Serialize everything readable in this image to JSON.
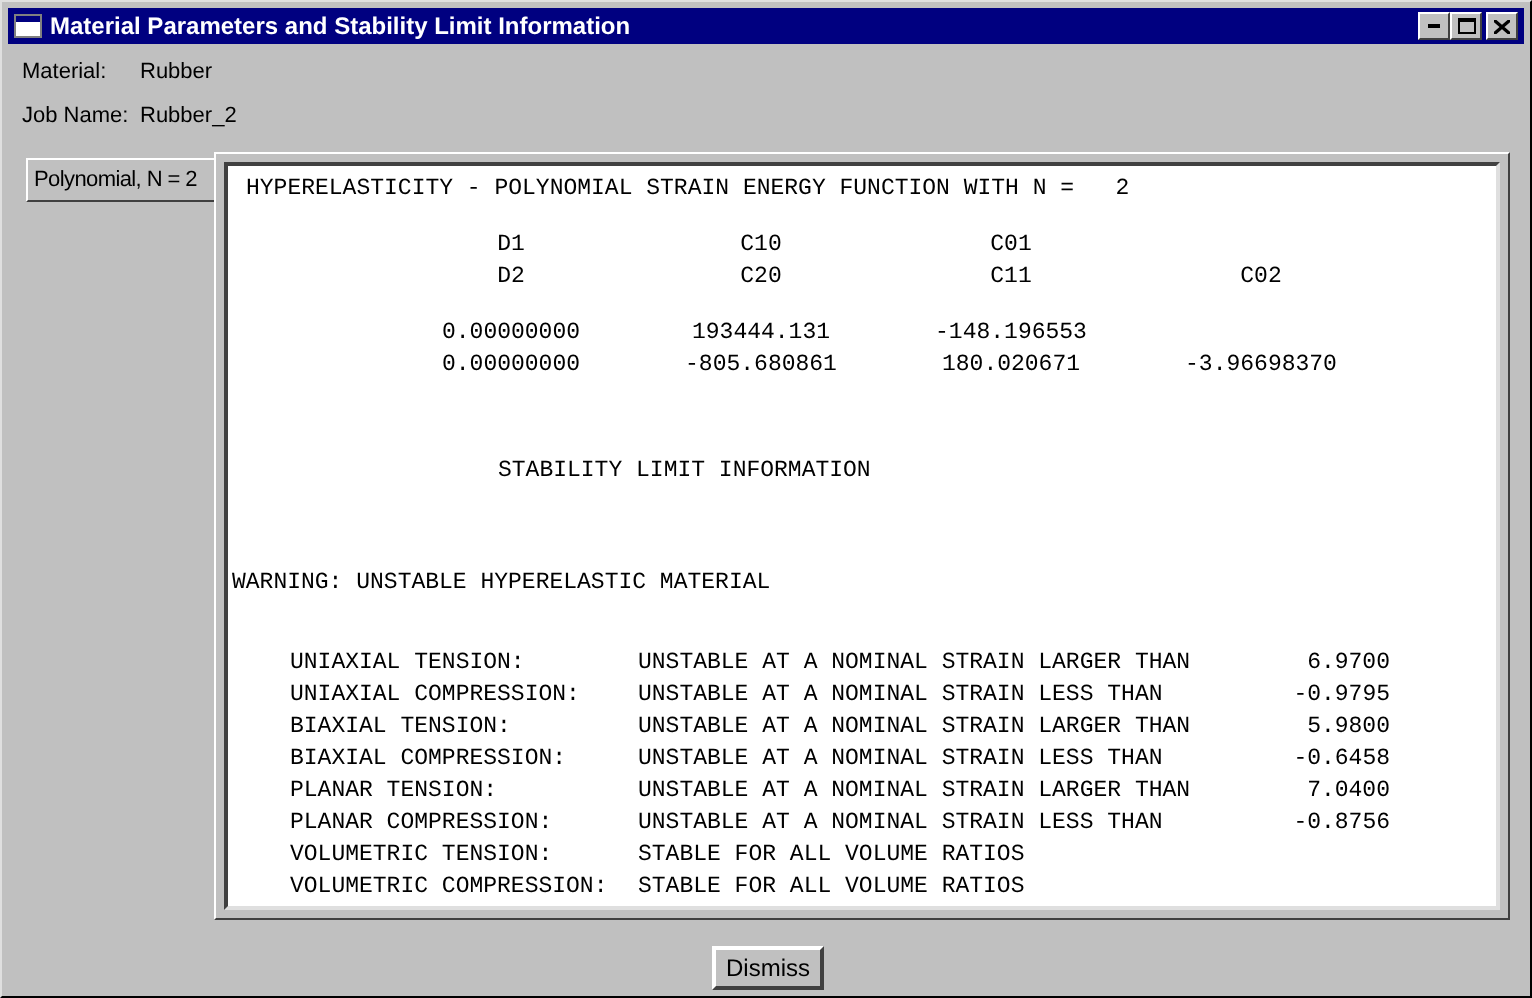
{
  "window": {
    "title": "Material Parameters and Stability Limit Information"
  },
  "fields": [
    {
      "label": "Material:",
      "value": "Rubber"
    },
    {
      "label": "Job Name:",
      "value": "Rubber_2"
    }
  ],
  "tabs": [
    {
      "label": "Polynomial, N = 2",
      "selected": true
    }
  ],
  "output": {
    "heading": "HYPERELASTICITY - POLYNOMIAL STRAIN ENERGY FUNCTION WITH N =   2",
    "coefficient_labels": [
      [
        "D1",
        "C10",
        "C01"
      ],
      [
        "D2",
        "C20",
        "C11",
        "C02"
      ]
    ],
    "coefficient_values": [
      [
        "0.00000000",
        "193444.131",
        "-148.196553"
      ],
      [
        "0.00000000",
        "-805.680861",
        "180.020671",
        "-3.96698370"
      ]
    ],
    "section_title": "STABILITY LIMIT INFORMATION",
    "warning": "WARNING: UNSTABLE HYPERELASTIC MATERIAL",
    "stability_rows": [
      {
        "mode": "UNIAXIAL TENSION:",
        "result": "UNSTABLE AT A NOMINAL STRAIN LARGER THAN",
        "value": "6.9700"
      },
      {
        "mode": "UNIAXIAL COMPRESSION:",
        "result": "UNSTABLE AT A NOMINAL STRAIN LESS THAN",
        "value": "-0.9795"
      },
      {
        "mode": "BIAXIAL TENSION:",
        "result": "UNSTABLE AT A NOMINAL STRAIN LARGER THAN",
        "value": "5.9800"
      },
      {
        "mode": "BIAXIAL COMPRESSION:",
        "result": "UNSTABLE AT A NOMINAL STRAIN LESS THAN",
        "value": "-0.6458"
      },
      {
        "mode": "PLANAR TENSION:",
        "result": "UNSTABLE AT A NOMINAL STRAIN LARGER THAN",
        "value": "7.0400"
      },
      {
        "mode": "PLANAR COMPRESSION:",
        "result": "UNSTABLE AT A NOMINAL STRAIN LESS THAN",
        "value": "-0.8756"
      },
      {
        "mode": "VOLUMETRIC TENSION:",
        "result": "STABLE FOR ALL VOLUME RATIOS"
      },
      {
        "mode": "VOLUMETRIC COMPRESSION:",
        "result": "STABLE FOR ALL VOLUME RATIOS"
      }
    ]
  },
  "buttons": [
    {
      "label": "Dismiss"
    }
  ]
}
